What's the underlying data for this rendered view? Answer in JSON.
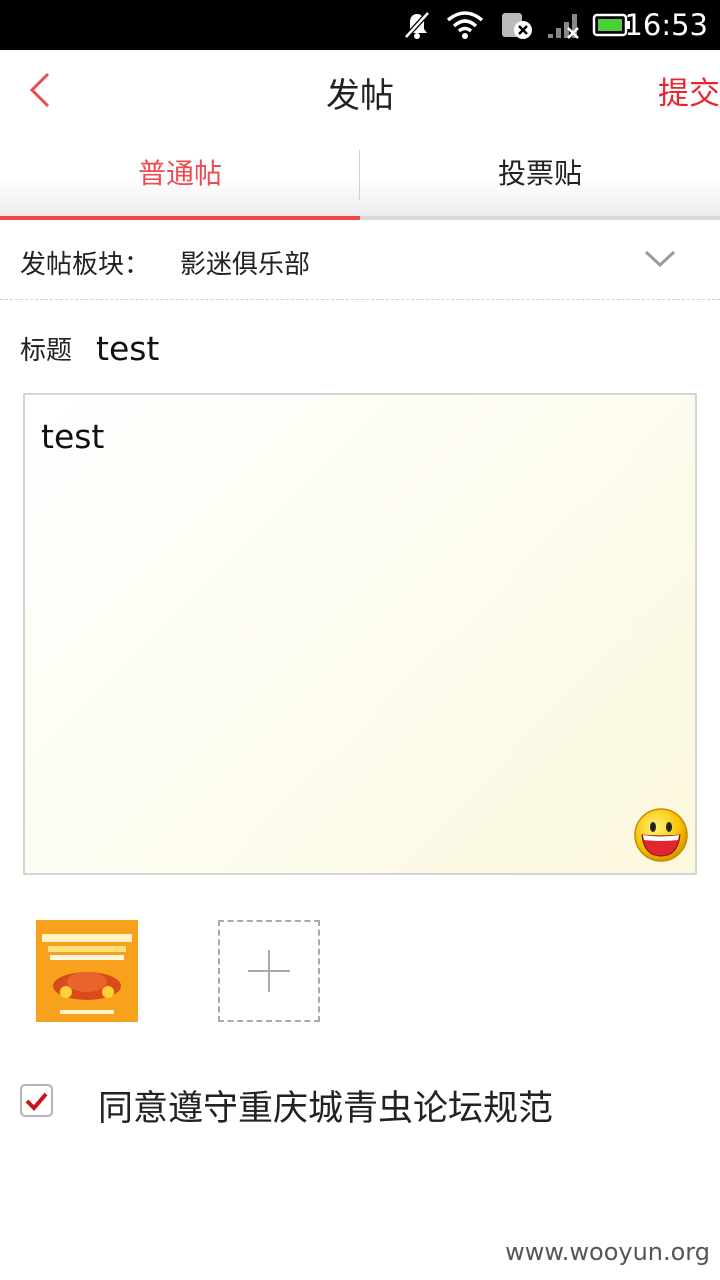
{
  "status_bar": {
    "time": "16:53",
    "icons": [
      "mute-icon",
      "wifi-icon",
      "sim-disabled-icon",
      "signal-icon",
      "battery-icon"
    ]
  },
  "header": {
    "back_icon": "chevron-left-icon",
    "title": "发帖",
    "submit_label": "提交"
  },
  "tabs": [
    {
      "label": "普通帖",
      "active": true
    },
    {
      "label": "投票贴",
      "active": false
    }
  ],
  "board": {
    "label": "发帖板块：",
    "value": "影迷俱乐部",
    "dropdown_icon": "chevron-down-icon"
  },
  "post_title": {
    "label": "标题",
    "value": "test"
  },
  "content": {
    "value": "test",
    "emoji_icon": "smiley-icon"
  },
  "images": {
    "thumbnail_icon": "image-thumbnail",
    "add_icon": "plus-icon"
  },
  "agreement": {
    "checked": true,
    "label": "同意遵守重庆城青虫论坛规范"
  },
  "watermark": "www.wooyun.org",
  "colors": {
    "accent": "#ee4a52",
    "submit": "#e8262e",
    "checkbox_check": "#c8161d"
  }
}
